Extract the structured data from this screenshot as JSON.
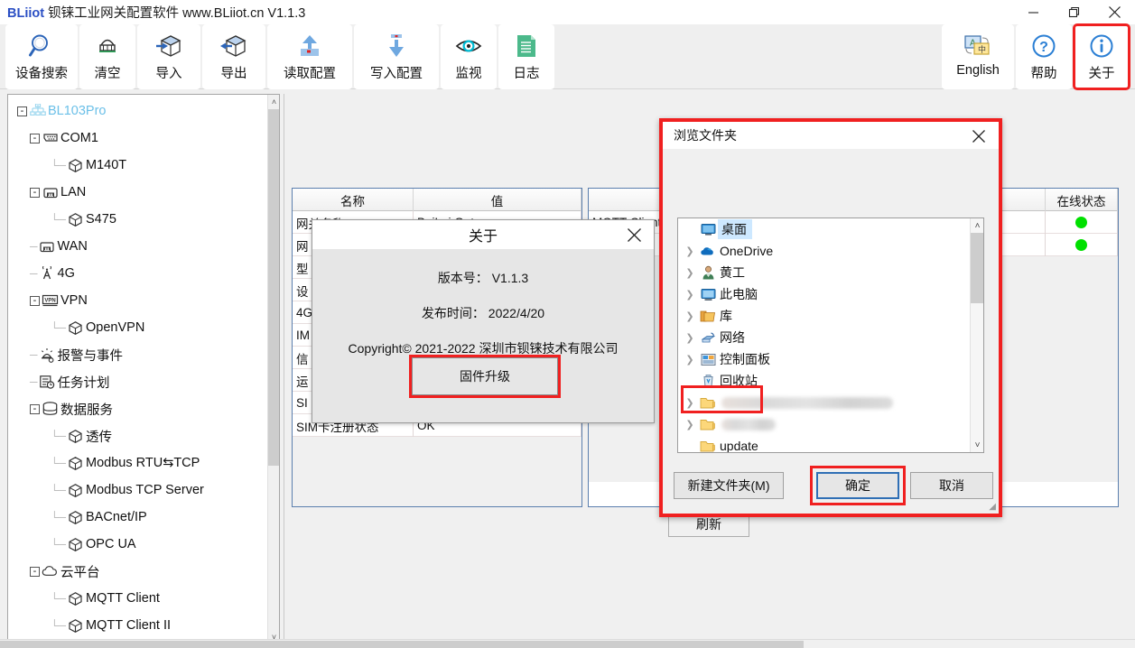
{
  "window": {
    "title_brand": "BLiiot",
    "title_rest": "钡铼工业网关配置软件 www.BLiiot.cn V1.1.3",
    "minimize": "—",
    "maximize": "❐",
    "close": "✕"
  },
  "toolbar": {
    "buttons": [
      {
        "label": "设备搜索",
        "icon": "magnifier-icon"
      },
      {
        "label": "清空",
        "icon": "broom-icon"
      },
      {
        "label": "导入",
        "icon": "import-box-icon"
      },
      {
        "label": "导出",
        "icon": "export-box-icon"
      },
      {
        "label": "读取配置",
        "icon": "upload-arrow-icon"
      },
      {
        "label": "写入配置",
        "icon": "download-arrow-icon"
      },
      {
        "label": "监视",
        "icon": "eye-icon"
      },
      {
        "label": "日志",
        "icon": "document-icon"
      }
    ],
    "right_buttons": [
      {
        "label": "English",
        "icon": "translate-icon",
        "highlighted": false
      },
      {
        "label": "帮助",
        "icon": "question-icon",
        "highlighted": false
      },
      {
        "label": "关于",
        "icon": "info-icon",
        "highlighted": true
      }
    ]
  },
  "sidebar": {
    "nodes": [
      {
        "label": "BL103Pro",
        "depth": 0,
        "expander": "-",
        "icon": "network-icon",
        "root": true
      },
      {
        "label": "COM1",
        "depth": 1,
        "expander": "-",
        "icon": "serial-port-icon"
      },
      {
        "label": "M140T",
        "depth": 2,
        "expander": "",
        "icon": "cube-icon"
      },
      {
        "label": "LAN",
        "depth": 1,
        "expander": "-",
        "icon": "ethernet-icon"
      },
      {
        "label": "S475",
        "depth": 2,
        "expander": "",
        "icon": "cube-icon"
      },
      {
        "label": "WAN",
        "depth": 1,
        "expander": "",
        "icon": "ethernet-icon"
      },
      {
        "label": "4G",
        "depth": 1,
        "expander": "",
        "icon": "antenna-icon"
      },
      {
        "label": "VPN",
        "depth": 1,
        "expander": "-",
        "icon": "vpn-icon"
      },
      {
        "label": "OpenVPN",
        "depth": 2,
        "expander": "",
        "icon": "cube-icon"
      },
      {
        "label": "报警与事件",
        "depth": 1,
        "expander": "",
        "icon": "alarm-icon"
      },
      {
        "label": "任务计划",
        "depth": 1,
        "expander": "",
        "icon": "schedule-icon"
      },
      {
        "label": "数据服务",
        "depth": 1,
        "expander": "-",
        "icon": "database-icon"
      },
      {
        "label": "透传",
        "depth": 2,
        "expander": "",
        "icon": "cube-icon"
      },
      {
        "label": "Modbus RTU⇆TCP",
        "depth": 2,
        "expander": "",
        "icon": "cube-icon"
      },
      {
        "label": "Modbus TCP Server",
        "depth": 2,
        "expander": "",
        "icon": "cube-icon"
      },
      {
        "label": "BACnet/IP",
        "depth": 2,
        "expander": "",
        "icon": "cube-icon"
      },
      {
        "label": "OPC UA",
        "depth": 2,
        "expander": "",
        "icon": "cube-icon"
      },
      {
        "label": "云平台",
        "depth": 1,
        "expander": "-",
        "icon": "cloud-icon"
      },
      {
        "label": "MQTT Client",
        "depth": 2,
        "expander": "",
        "icon": "cube-icon"
      },
      {
        "label": "MQTT Client II",
        "depth": 2,
        "expander": "",
        "icon": "cube-icon"
      }
    ],
    "scroll_up": "˄",
    "scroll_down": "˅"
  },
  "main": {
    "left_grid": {
      "headers": [
        "名称",
        "值"
      ],
      "rows": [
        {
          "name": "网关名称",
          "value": "BeiLai Gateway"
        },
        {
          "name": "网",
          "value": ""
        },
        {
          "name": "型",
          "value": ""
        },
        {
          "name": "设",
          "value": ""
        },
        {
          "name": "4G",
          "value": ""
        },
        {
          "name": "IM",
          "value": ""
        },
        {
          "name": "信",
          "value": ""
        },
        {
          "name": "运",
          "value": ""
        },
        {
          "name": "SI",
          "value": ""
        },
        {
          "name": "SIM卡注册状态",
          "value": "OK"
        }
      ]
    },
    "right_grid": {
      "headers": [
        "",
        "在线状态"
      ],
      "rows": [
        {
          "name": "MQTT Client",
          "status": "online"
        },
        {
          "name": "",
          "status": "online"
        }
      ]
    },
    "refresh_button": "刷新"
  },
  "about_dialog": {
    "title": "关于",
    "close": "✕",
    "version_line": "版本号： V1.1.3",
    "release_line": "发布时间： 2022/4/20",
    "copyright_line": "Copyright© 2021-2022 深圳市钡铼技术有限公司",
    "firmware_button": "固件升级"
  },
  "browse_dialog": {
    "title": "浏览文件夹",
    "close": "✕",
    "tree": [
      {
        "label": "桌面",
        "icon": "desktop-icon",
        "chevron": false,
        "selected": true,
        "blurred": false
      },
      {
        "label": "OneDrive",
        "icon": "onedrive-icon",
        "chevron": true,
        "selected": false,
        "blurred": false
      },
      {
        "label": "黄工",
        "icon": "user-icon",
        "chevron": true,
        "selected": false,
        "blurred": false
      },
      {
        "label": "此电脑",
        "icon": "this-pc-icon",
        "chevron": true,
        "selected": false,
        "blurred": false
      },
      {
        "label": "库",
        "icon": "library-icon",
        "chevron": true,
        "selected": false,
        "blurred": false
      },
      {
        "label": "网络",
        "icon": "network-place-icon",
        "chevron": true,
        "selected": false,
        "blurred": false
      },
      {
        "label": "控制面板",
        "icon": "control-panel-icon",
        "chevron": true,
        "selected": false,
        "blurred": false
      },
      {
        "label": "回收站",
        "icon": "recycle-bin-icon",
        "chevron": false,
        "selected": false,
        "blurred": false
      },
      {
        "label": "",
        "icon": "folder-icon",
        "chevron": true,
        "selected": false,
        "blurred": true
      },
      {
        "label": "",
        "icon": "folder-icon",
        "chevron": true,
        "selected": false,
        "blurred": true
      },
      {
        "label": "update",
        "icon": "folder-icon",
        "chevron": false,
        "selected": false,
        "blurred": false
      },
      {
        "label": "",
        "icon": "folder-icon",
        "chevron": true,
        "selected": false,
        "blurred": true
      },
      {
        "label": "",
        "icon": "folder-icon",
        "chevron": true,
        "selected": false,
        "blurred": true
      }
    ],
    "scroll_up": "˄",
    "scroll_down": "˅",
    "new_folder_button": "新建文件夹(M)",
    "ok_button": "确定",
    "cancel_button": "取消"
  },
  "colors": {
    "highlight_red": "#f02020",
    "accent_blue": "#2f6fb5",
    "online_green": "#00e000",
    "brand_blue": "#2b4fc4"
  }
}
